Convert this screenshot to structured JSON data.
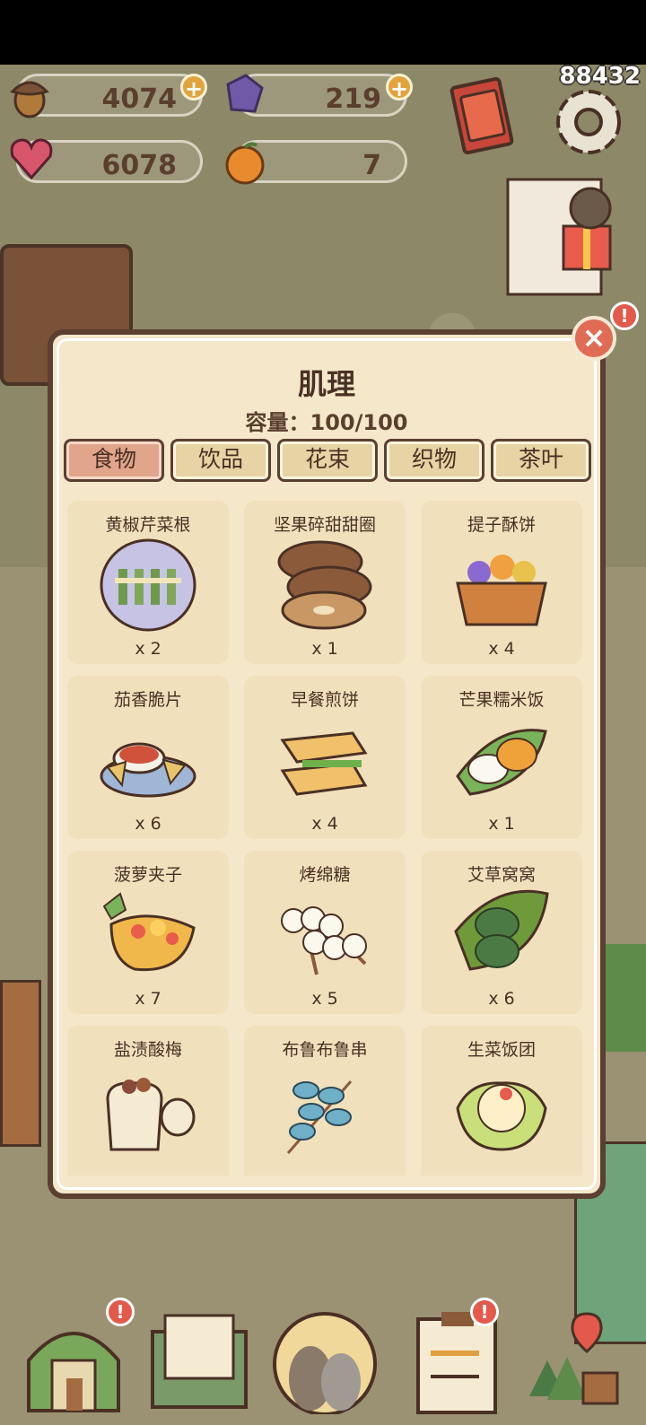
{
  "resources": {
    "acorn": {
      "value": "4074",
      "icon": "acorn-icon"
    },
    "gem": {
      "value": "219",
      "icon": "gem-icon"
    },
    "heart": {
      "value": "6078",
      "icon": "heart-icon"
    },
    "orange": {
      "value": "7",
      "icon": "orange-icon"
    }
  },
  "corner_number": "88432",
  "panel": {
    "title": "肌理",
    "capacity": "容量：100/100",
    "close_label": "×",
    "tabs": [
      {
        "label": "食物",
        "active": true
      },
      {
        "label": "饮品",
        "active": false
      },
      {
        "label": "花束",
        "active": false
      },
      {
        "label": "织物",
        "active": false
      },
      {
        "label": "茶叶",
        "active": false
      }
    ],
    "items": [
      {
        "name": "黄椒芹菜根",
        "count": "x 2",
        "icon": "celery-plate-icon"
      },
      {
        "name": "坚果碎甜甜圈",
        "count": "x 1",
        "icon": "donut-stack-icon"
      },
      {
        "name": "提子酥饼",
        "count": "x 4",
        "icon": "fruit-basket-icon"
      },
      {
        "name": "茄香脆片",
        "count": "x 6",
        "icon": "chips-dip-icon"
      },
      {
        "name": "早餐煎饼",
        "count": "x 4",
        "icon": "sandwich-icon"
      },
      {
        "name": "芒果糯米饭",
        "count": "x 1",
        "icon": "mango-rice-icon"
      },
      {
        "name": "菠萝夹子",
        "count": "x 7",
        "icon": "pineapple-boat-icon"
      },
      {
        "name": "烤绵糖",
        "count": "x 5",
        "icon": "marshmallow-skewer-icon"
      },
      {
        "name": "艾草窝窝",
        "count": "x 6",
        "icon": "mugwort-cake-icon"
      },
      {
        "name": "盐渍酸梅",
        "count": "",
        "icon": "plum-jar-icon"
      },
      {
        "name": "布鲁布鲁串",
        "count": "",
        "icon": "candy-skewer-icon"
      },
      {
        "name": "生菜饭团",
        "count": "",
        "icon": "lettuce-riceball-icon"
      }
    ]
  },
  "colors": {
    "panel_bg": "#f4e7ca",
    "panel_border": "#5b3f31",
    "tab_active": "#e0a58a",
    "tab_inactive": "#e7d3a3",
    "text": "#4a3024"
  }
}
